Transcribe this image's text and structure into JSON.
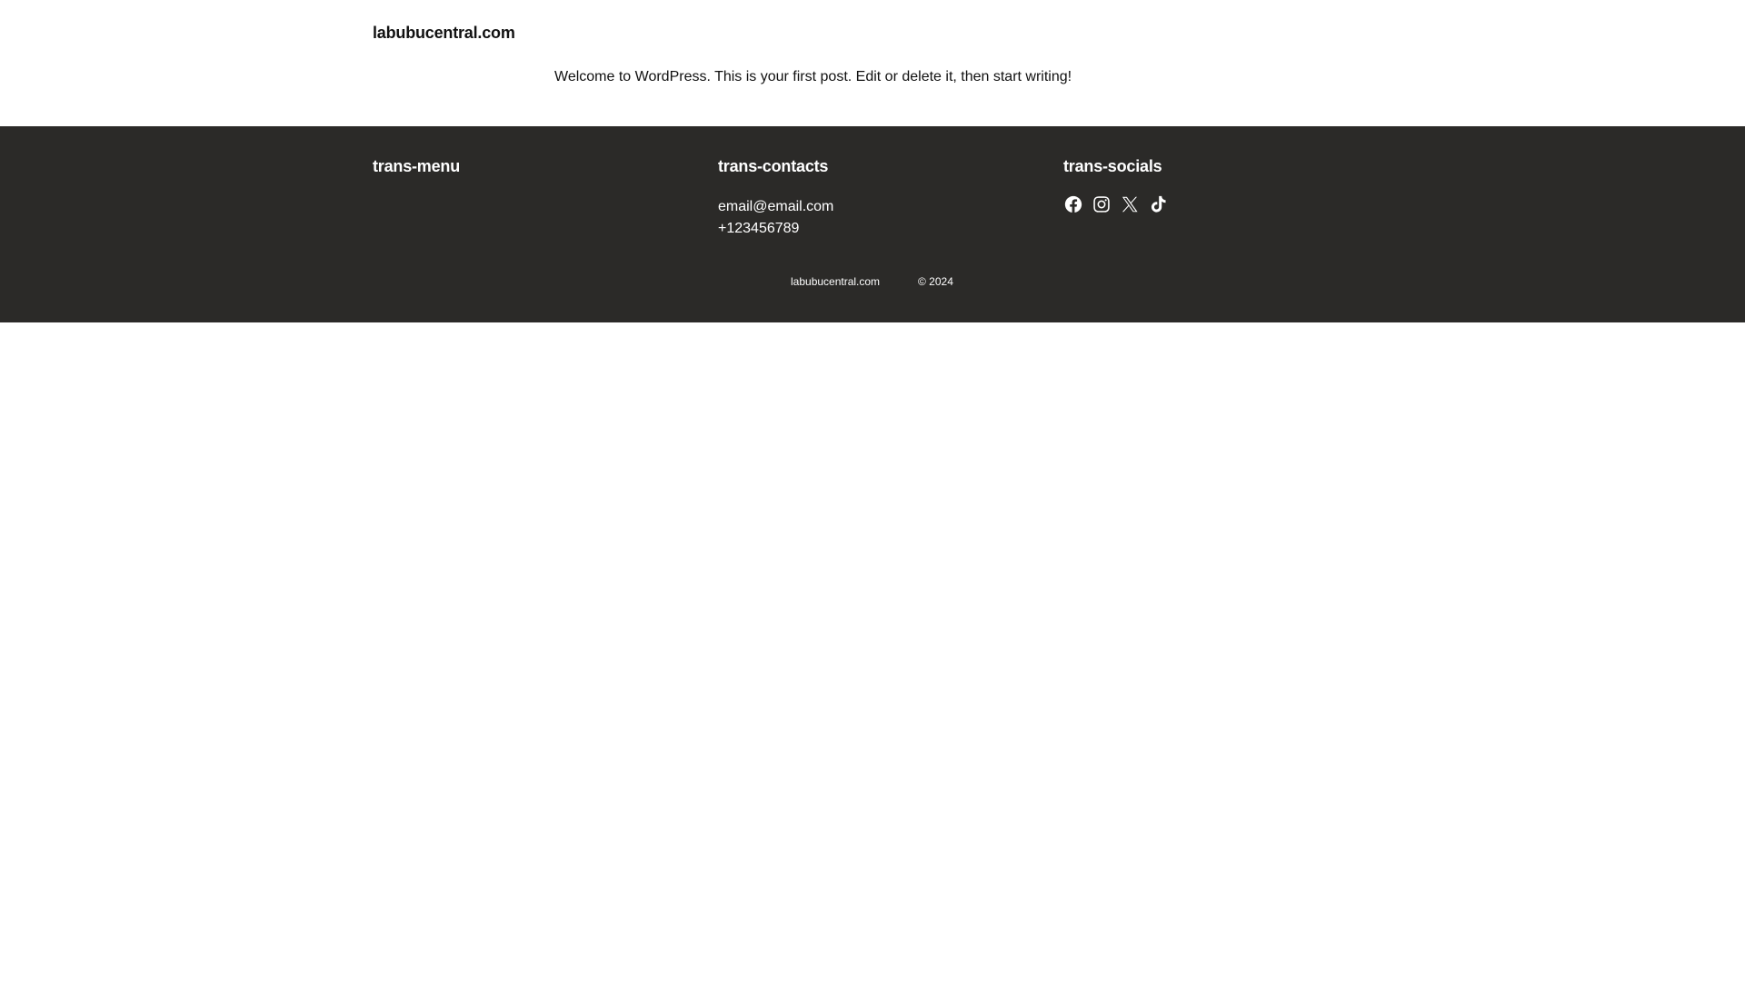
{
  "header": {
    "site_title": "labubucentral.com"
  },
  "main": {
    "post_text": "Welcome to WordPress. This is your first post. Edit or delete it, then start writing!"
  },
  "footer": {
    "menu": {
      "heading": "trans-menu"
    },
    "contacts": {
      "heading": "trans-contacts",
      "email": "email@email.com",
      "phone": "+123456789"
    },
    "socials": {
      "heading": "trans-socials",
      "icons": [
        "facebook-icon",
        "instagram-icon",
        "x-icon",
        "tiktok-icon"
      ]
    },
    "bottom": {
      "site_name": "labubucentral.com",
      "copyright": "© 2024"
    }
  },
  "colors": {
    "footer_background": "#2b2a28",
    "footer_text": "#ffffff",
    "page_background": "#ffffff",
    "body_text": "#111111"
  }
}
